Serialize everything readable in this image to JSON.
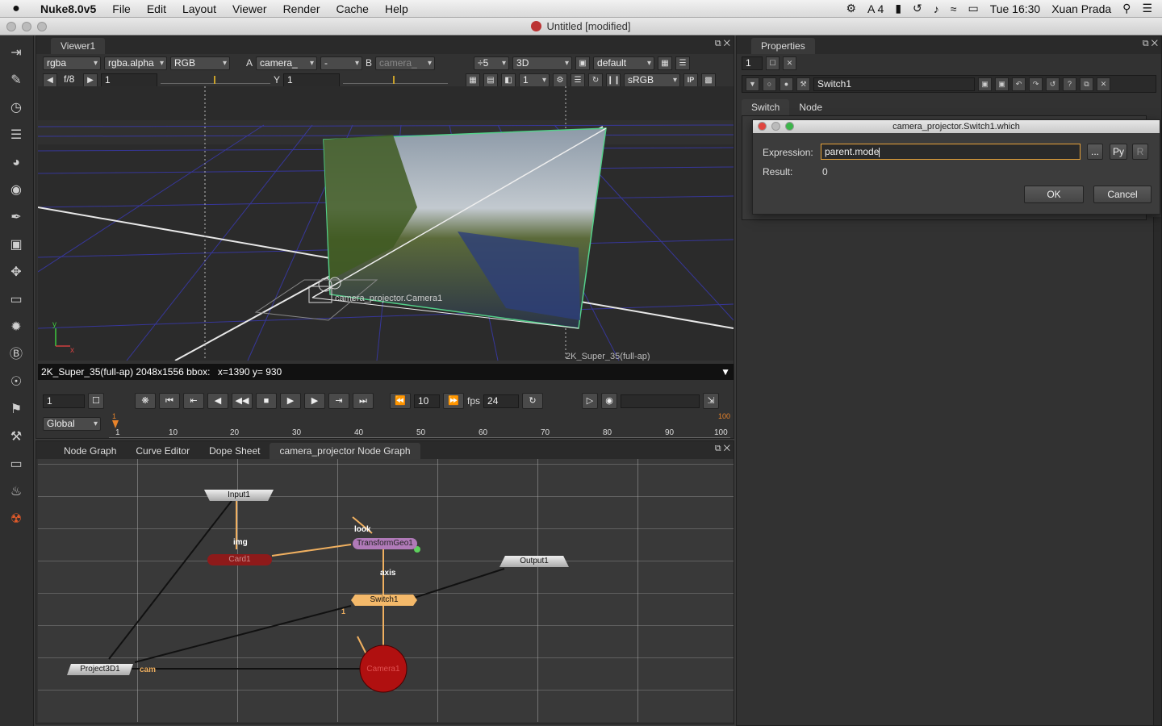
{
  "menubar": {
    "app_name": "Nuke8.0v5",
    "items": [
      "File",
      "Edit",
      "Layout",
      "Viewer",
      "Render",
      "Cache",
      "Help"
    ],
    "status": {
      "adobe_count": "4",
      "clock": "Tue 16:30",
      "user": "Xuan Prada"
    }
  },
  "window": {
    "title": "Untitled [modified]"
  },
  "viewer": {
    "tab_label": "Viewer1",
    "channels": "rgba",
    "alpha_channel": "rgba.alpha",
    "colorspace_display": "RGB",
    "input_a_label": "A",
    "input_a": "camera_",
    "blend": "-",
    "input_b_label": "B",
    "input_b": "camera_",
    "downrez": "÷5",
    "view_mode": "3D",
    "lut": "default",
    "fstop": "f/8",
    "gain": "1",
    "gamma_label": "Y",
    "gamma": "1",
    "frame_field": "1",
    "lut_out": "sRGB",
    "ip_label": "IP",
    "camera_label": "camera_projector.Camera1",
    "format_overlay": "2K_Super_35(full-ap)",
    "info_bar_format": "2K_Super_35(full-ap) 2048x1556 bbox:",
    "info_bar_coords": "x=1390 y= 930",
    "axis_x": "x",
    "axis_y": "y"
  },
  "timeline": {
    "current_frame": "1",
    "step": "10",
    "fps_label": "fps",
    "fps": "24",
    "range_mode": "Global",
    "in_marker": "1",
    "out_marker": "100",
    "ticks": [
      "1",
      "10",
      "20",
      "30",
      "40",
      "50",
      "60",
      "70",
      "80",
      "90",
      "100"
    ]
  },
  "node_graph": {
    "tabs": [
      "Node Graph",
      "Curve Editor",
      "Dope Sheet",
      "camera_projector Node Graph"
    ],
    "nodes": {
      "input": "Input1",
      "card": "Card1",
      "transform_geo": "TransformGeo1",
      "output": "Output1",
      "switch": "Switch1",
      "project3d": "Project3D1",
      "camera": "Camera1"
    },
    "pipe_labels": {
      "img": "img",
      "look": "look",
      "axis": "axis",
      "cam": "cam",
      "switch_input": "1"
    }
  },
  "properties": {
    "tab_label": "Properties",
    "max_panels": "1",
    "node_name": "Switch1",
    "tabs": [
      "Switch",
      "Node"
    ]
  },
  "expression_dialog": {
    "title": "camera_projector.Switch1.which",
    "expression_label": "Expression:",
    "expression_value": "parent.mode",
    "result_label": "Result:",
    "result_value": "0",
    "ellipsis_label": "...",
    "py_label": "Py",
    "r_label": "R",
    "ok_label": "OK",
    "cancel_label": "Cancel"
  },
  "colors": {
    "switch_node": "#f4b96a",
    "transform_node": "#b07ab8",
    "card_node": "#8e1a1a",
    "camera_node": "#b01010",
    "pipe_orange": "#f0b060",
    "focus_orange": "#e8a33a"
  }
}
